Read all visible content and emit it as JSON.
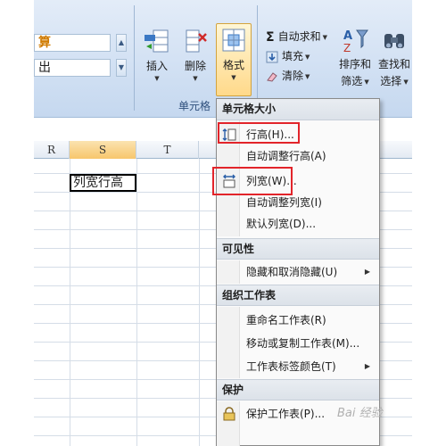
{
  "ribbon": {
    "styles_group": {
      "conditional_label": "算",
      "output_label": "出"
    },
    "cells_group": {
      "insert_label": "插入",
      "delete_label": "删除",
      "format_label": "格式",
      "group_label": "单元格"
    },
    "editing_group": {
      "autosum_label": "自动求和",
      "fill_label": "填充",
      "clear_label": "清除",
      "sort_label_line1": "排序和",
      "sort_label_line2": "筛选",
      "find_label_line1": "查找和",
      "find_label_line2": "选择"
    }
  },
  "sheet": {
    "columns": [
      "R",
      "S",
      "T"
    ],
    "active_column": "S",
    "active_cell_value": "列宽行高"
  },
  "format_menu": {
    "sections": [
      {
        "header": "单元格大小",
        "items": [
          {
            "label": "行高(H)...",
            "icon": "row-height-icon",
            "highlighted": true
          },
          {
            "label": "自动调整行高(A)"
          },
          {
            "label": "列宽(W)...",
            "icon": "column-width-icon",
            "highlighted": true
          },
          {
            "label": "自动调整列宽(I)"
          },
          {
            "label": "默认列宽(D)..."
          }
        ]
      },
      {
        "header": "可见性",
        "items": [
          {
            "label": "隐藏和取消隐藏(U)",
            "submenu": true
          }
        ]
      },
      {
        "header": "组织工作表",
        "items": [
          {
            "label": "重命名工作表(R)"
          },
          {
            "label": "移动或复制工作表(M)..."
          },
          {
            "label": "工作表标签颜色(T)",
            "submenu": true
          }
        ]
      },
      {
        "header": "保护",
        "items": [
          {
            "label": "保护工作表(P)...",
            "icon": "lock-icon"
          }
        ]
      }
    ]
  },
  "colors": {
    "highlight_box": "#e2242a",
    "ribbon_bg": "#d1e0f3",
    "active_column_header": "#f7c66c"
  },
  "watermark": "Bai 经验"
}
